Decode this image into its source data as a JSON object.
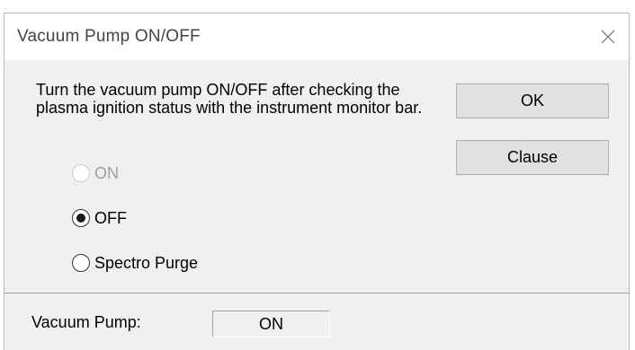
{
  "window": {
    "title": "Vacuum Pump ON/OFF"
  },
  "message": "Turn the vacuum pump ON/OFF after checking the plasma ignition status with the instrument monitor bar.",
  "buttons": {
    "ok_label": "OK",
    "clause_label": "Clause"
  },
  "options": [
    {
      "label": "ON",
      "selected": false,
      "disabled": true
    },
    {
      "label": "OFF",
      "selected": true,
      "disabled": false
    },
    {
      "label": "Spectro Purge",
      "selected": false,
      "disabled": false
    }
  ],
  "status": {
    "label": "Vacuum Pump:",
    "value": "ON"
  },
  "icons": {
    "close": "close-icon"
  }
}
